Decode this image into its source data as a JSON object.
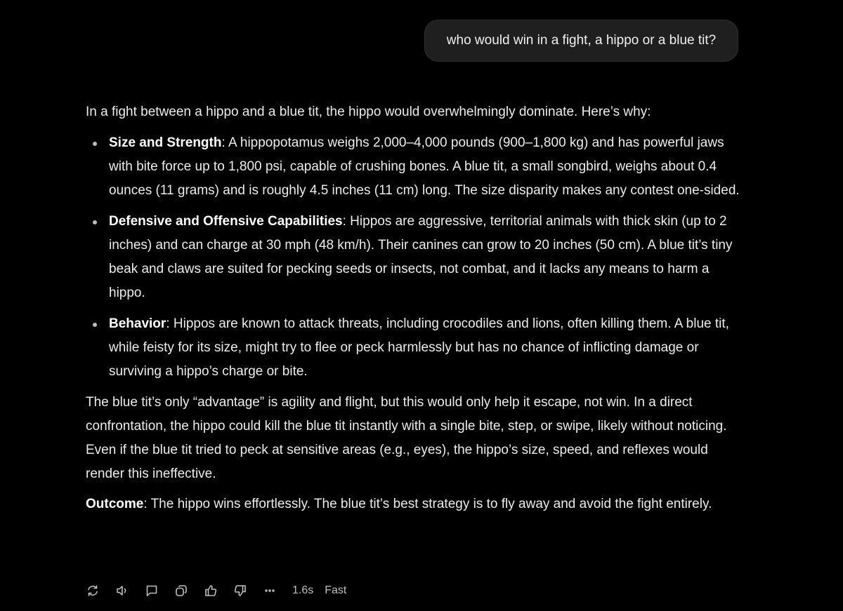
{
  "user_message": "who would win in a fight, a hippo or a blue tit?",
  "response": {
    "intro": "In a fight between a hippo and a blue tit, the hippo would overwhelmingly dominate. Here’s why:",
    "bullets": [
      {
        "title": "Size and Strength",
        "text": ": A hippopotamus weighs 2,000–4,000 pounds (900–1,800 kg) and has powerful jaws with bite force up to 1,800 psi, capable of crushing bones. A blue tit, a small songbird, weighs about 0.4 ounces (11 grams) and is roughly 4.5 inches (11 cm) long. The size disparity makes any contest one-sided."
      },
      {
        "title": "Defensive and Offensive Capabilities",
        "text": ": Hippos are aggressive, territorial animals with thick skin (up to 2 inches) and can charge at 30 mph (48 km/h). Their canines can grow to 20 inches (50 cm). A blue tit’s tiny beak and claws are suited for pecking seeds or insects, not combat, and it lacks any means to harm a hippo."
      },
      {
        "title": "Behavior",
        "text": ": Hippos are known to attack threats, including crocodiles and lions, often killing them. A blue tit, while feisty for its size, might try to flee or peck harmlessly but has no chance of inflicting damage or surviving a hippo’s charge or bite."
      }
    ],
    "paragraph": "The blue tit’s only “advantage” is agility and flight, but this would only help it escape, not win. In a direct confrontation, the hippo could kill the blue tit instantly with a single bite, step, or swipe, likely without noticing. Even if the blue tit tried to peck at sensitive areas (e.g., eyes), the hippo’s size, speed, and reflexes would render this ineffective.",
    "outcome_label": "Outcome",
    "outcome_text": ": The hippo wins effortlessly. The blue tit’s best strategy is to fly away and avoid the fight entirely."
  },
  "actions": {
    "icons": [
      "regenerate-icon",
      "read-aloud-icon",
      "comment-icon",
      "copy-icon",
      "thumbs-up-icon",
      "thumbs-down-icon",
      "more-icon"
    ],
    "time": "1.6s",
    "mode": "Fast"
  },
  "colors": {
    "background": "#000000",
    "bubble": "#1f1f1f",
    "text": "#ececec",
    "muted": "#bdbdbd"
  }
}
